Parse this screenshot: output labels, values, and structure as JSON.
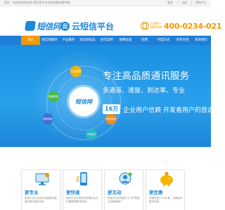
{
  "topbar": {
    "welcome": "您好，欢迎来到短信网-我们是专业的短信服务提供商",
    "links": [
      "登录",
      "|",
      "注册",
      "|",
      "帮助中心"
    ]
  },
  "header": {
    "logo_primary": "短信网",
    "logo_secondary": "云短信平台",
    "logo_secondary_mark": "云",
    "hotline_label_1": "全国统一",
    "hotline_label_2": "服务热线",
    "hotline": "400-0234-021"
  },
  "nav": {
    "items": [
      "首页",
      "短信网服务",
      "产品服务",
      "短信网动态",
      "合作案例",
      "收费标准",
      "招聘",
      "代理方式",
      "开发文档",
      "联系我们"
    ],
    "active_index": 0
  },
  "banner": {
    "headline": "专注高品质通讯服务",
    "subline": "多通道、速度、到达率、专业",
    "stat_number": "16万",
    "stat_text": "企业用户信赖  开发者用户的首选",
    "center_logo": "短信网",
    "bubbles": [
      "行业短信",
      "营销短信",
      "语音验证",
      "短信验证",
      "API接口"
    ]
  },
  "features": [
    {
      "title": "更专业",
      "desc": "短信平台已实现对运营商的通道对接与整合优化"
    },
    {
      "title": "更快速",
      "desc": "短信平台对短信发送提供全方位通道保障5秒到达"
    },
    {
      "title": "更互动",
      "desc": "短信平台支持用户上下行短信互动营销推广"
    },
    {
      "title": "更优惠",
      "desc": "资费低至0.03元/条，长期合作更多优惠"
    }
  ],
  "colors": {
    "brand_blue": "#1e88d8",
    "nav_blue": "#1f7ed6",
    "accent_orange": "#f39800"
  }
}
